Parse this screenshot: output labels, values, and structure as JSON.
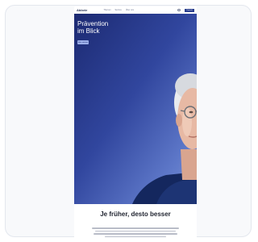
{
  "nav": {
    "logo": "Abbvie",
    "links": [
      "Themen",
      "Service",
      "Über uns"
    ],
    "cta_label": "Kontakt"
  },
  "hero": {
    "title_line1": "Prävention",
    "title_line2": "im Blick",
    "button_label": "Mehr erfahren"
  },
  "section": {
    "title": "Je früher, desto besser"
  },
  "colors": {
    "hero_dark": "#1c2a72",
    "hero_light": "#7a94da",
    "cta": "#2b3f8e"
  }
}
